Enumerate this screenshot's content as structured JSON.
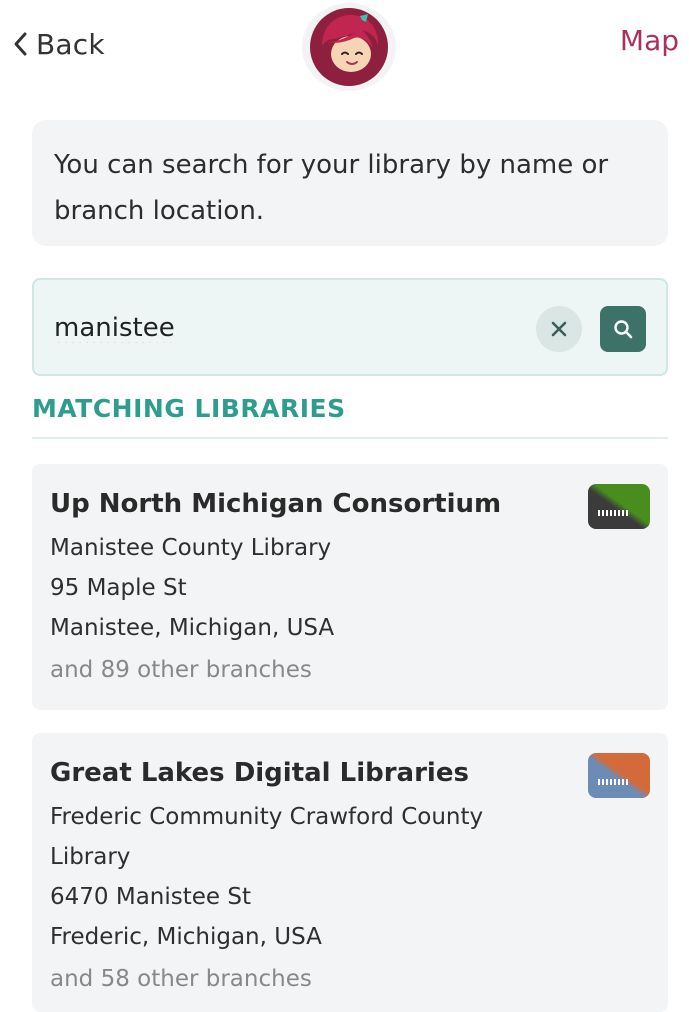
{
  "header": {
    "back_label": "Back",
    "map_label": "Map"
  },
  "info": {
    "text": "You can search for your library by name or branch location."
  },
  "search": {
    "value": "manistee"
  },
  "results": {
    "section_title": "MATCHING LIBRARIES",
    "libraries": [
      {
        "name": "Up North Michigan Consortium",
        "branch": "Manistee County Library",
        "street": "95 Maple St",
        "city": "Manistee, Michigan, USA",
        "more": "and 89 other branches",
        "badge_colors": [
          "#3b3b3b",
          "#4a8d1f"
        ]
      },
      {
        "name": "Great Lakes Digital Libraries",
        "branch": "Frederic Community Crawford County Library",
        "street": "6470 Manistee St",
        "city": "Frederic, Michigan, USA",
        "more": "and 58 other branches",
        "badge_colors": [
          "#6c8cb5",
          "#d46a3a"
        ]
      }
    ]
  },
  "colors": {
    "accent": "#a8325e",
    "teal": "#2f9c90",
    "search_button": "#3d7268"
  }
}
